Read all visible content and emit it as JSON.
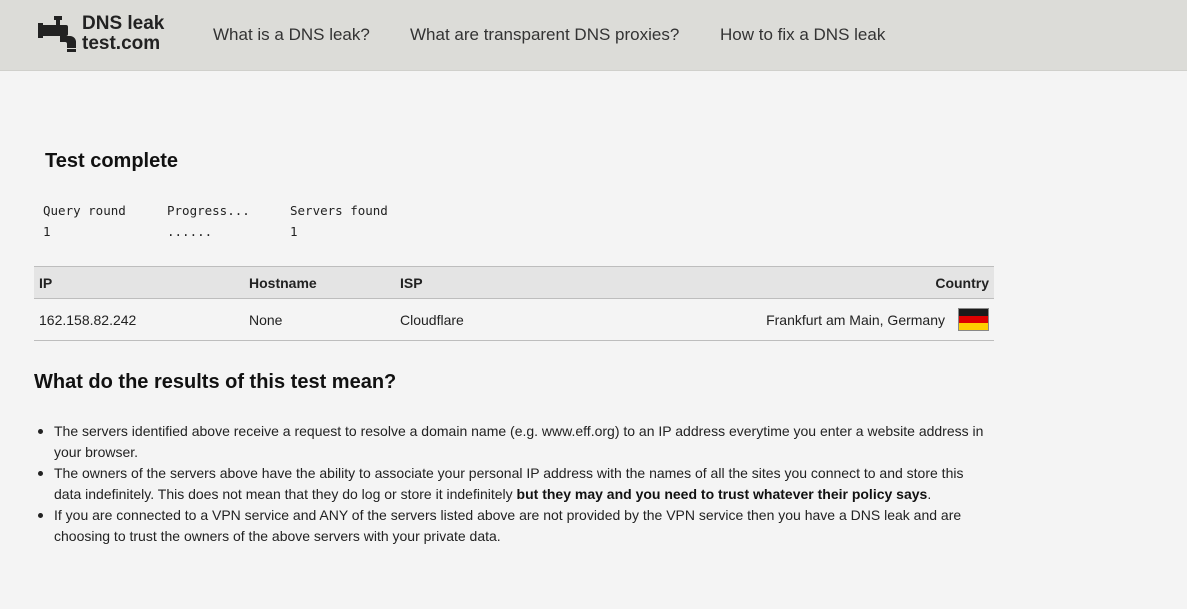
{
  "header": {
    "logo": {
      "line1": "DNS leak",
      "line2": "test.com"
    },
    "nav": [
      {
        "label": "What is a DNS leak?"
      },
      {
        "label": "What are transparent DNS proxies?"
      },
      {
        "label": "How to fix a DNS leak"
      }
    ]
  },
  "status": {
    "title": "Test complete",
    "labels": {
      "query_round": "Query round",
      "progress": "Progress...",
      "servers_found": "Servers found"
    },
    "values": {
      "query_round": "1",
      "progress": "......",
      "servers_found": "1"
    }
  },
  "results_table": {
    "columns": [
      "IP",
      "Hostname",
      "ISP",
      "Country"
    ],
    "rows": [
      {
        "ip": "162.158.82.242",
        "hostname": "None",
        "isp": "Cloudflare",
        "country": "Frankfurt am Main, Germany",
        "flag": "germany-flag"
      }
    ]
  },
  "flag_colors": {
    "black": "#1a1a1a",
    "red": "#dd0000",
    "gold": "#ffce00"
  },
  "explanation": {
    "title": "What do the results of this test mean?",
    "bullets": [
      {
        "text": "The servers identified above receive a request to resolve a domain name (e.g. www.eff.org) to an IP address everytime you enter a website address in your browser."
      },
      {
        "text": "The owners of the servers above have the ability to associate your personal IP address with the names of all the sites you connect to and store this data indefinitely. This does not mean that they do log or store it indefinitely ",
        "bold": "but they may and you need to trust whatever their policy says",
        "tail": "."
      },
      {
        "text": "If you are connected to a VPN service and ANY of the servers listed above are not provided by the VPN service then you have a DNS leak and are choosing to trust the owners of the above servers with your private data."
      }
    ]
  }
}
